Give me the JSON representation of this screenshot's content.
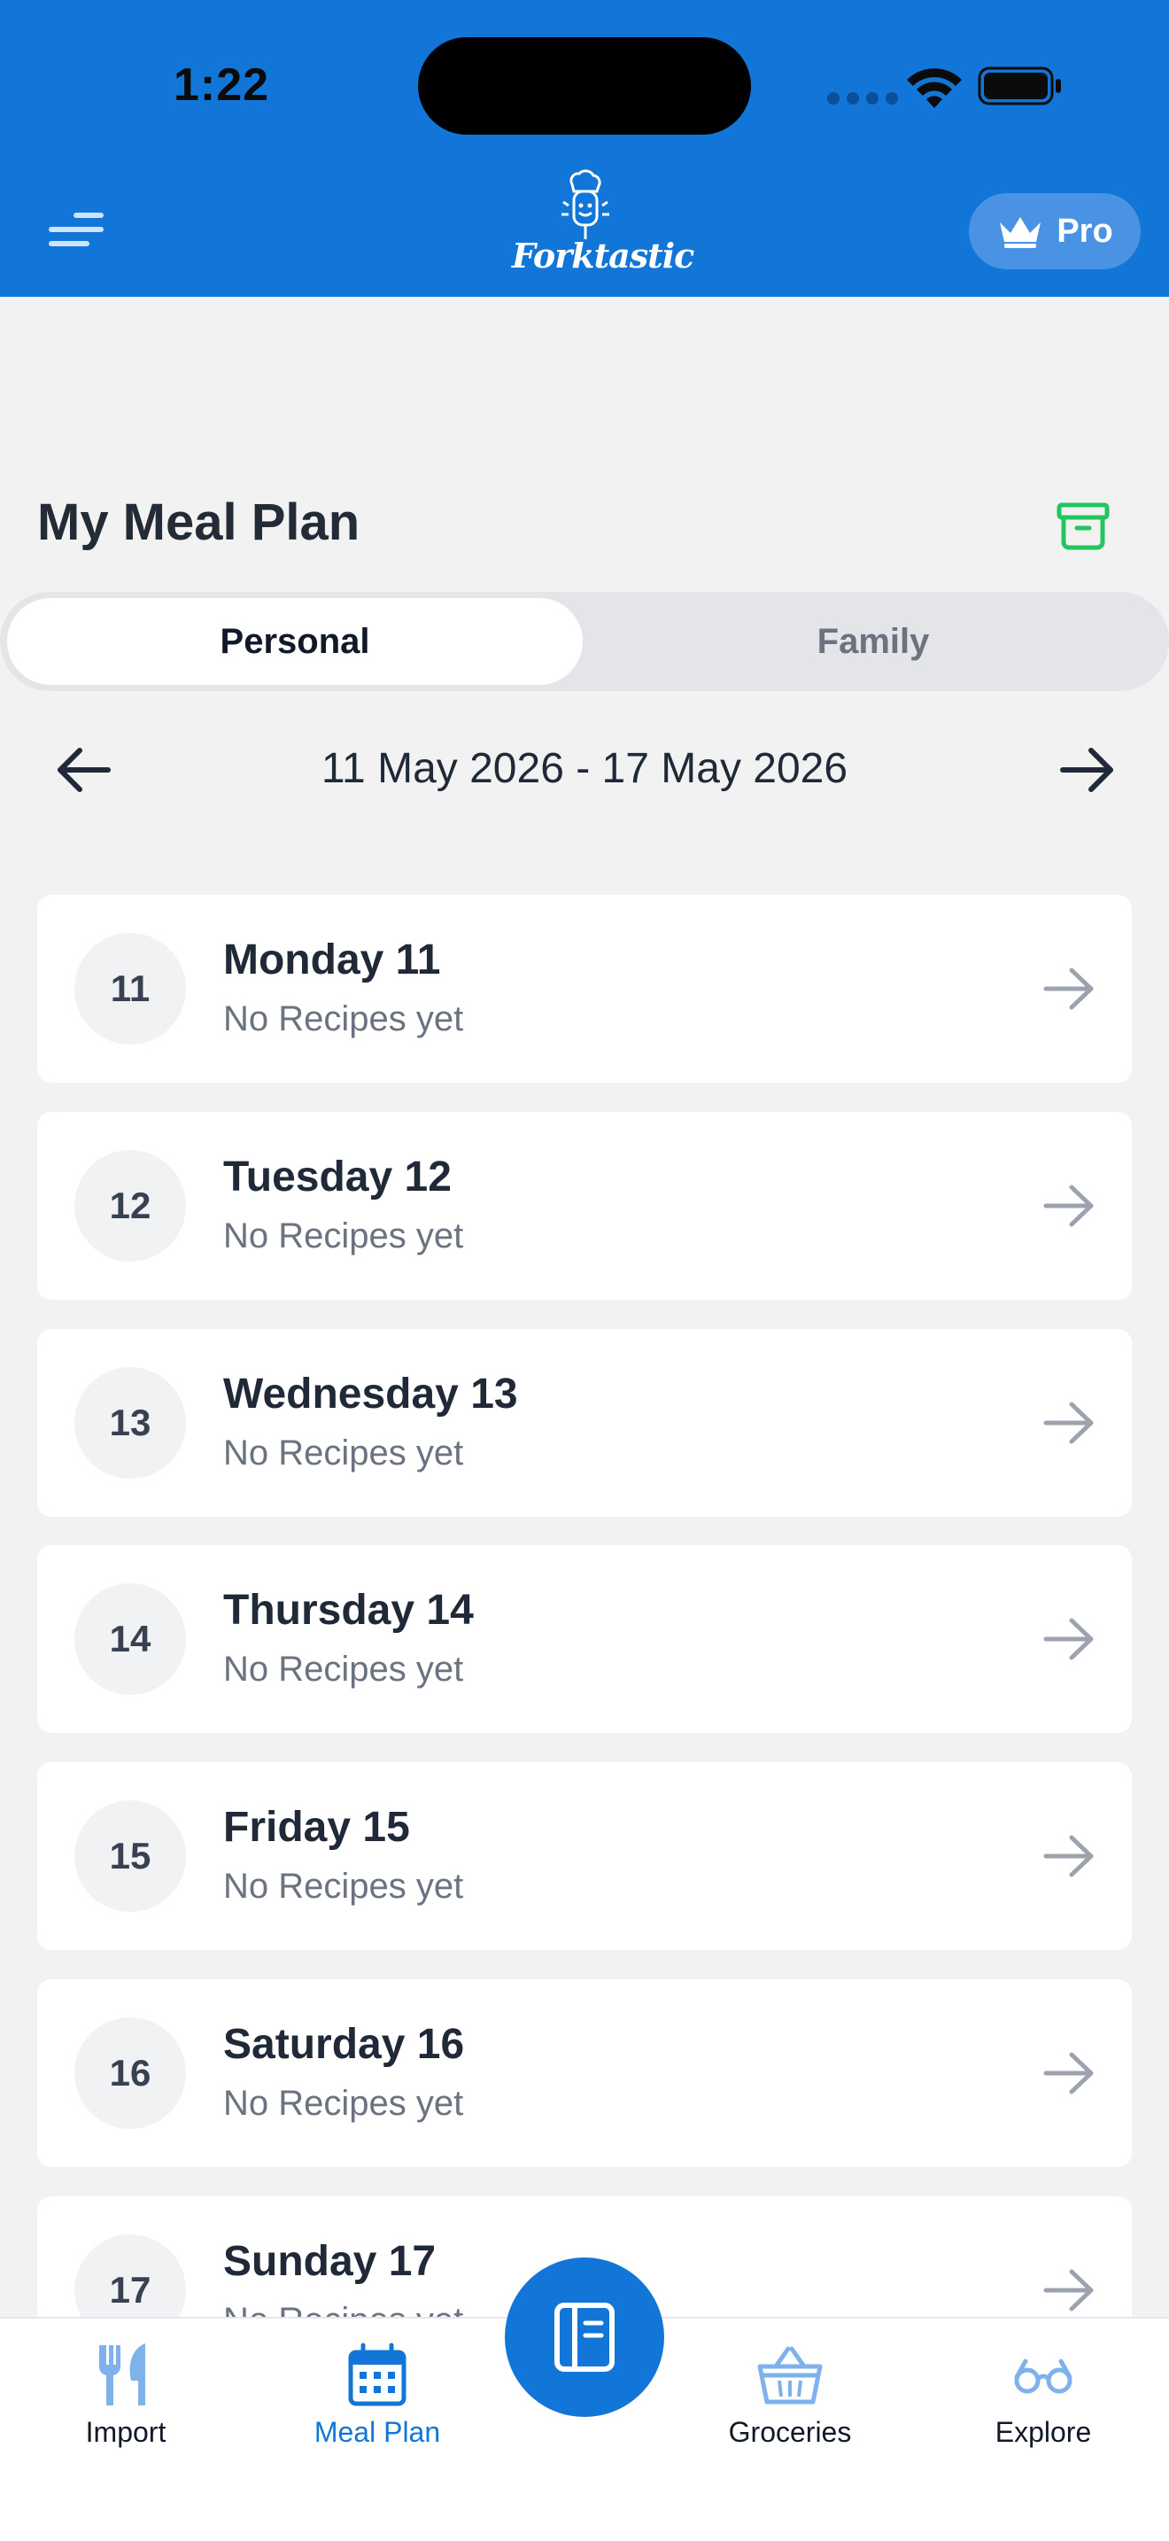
{
  "status_bar": {
    "time": "1:22"
  },
  "header": {
    "logo_text": "Forktastic",
    "pro_label": "Pro"
  },
  "page": {
    "title": "My Meal Plan"
  },
  "tabs": [
    {
      "label": "Personal",
      "selected": true
    },
    {
      "label": "Family",
      "selected": false
    }
  ],
  "week": {
    "range": "11 May 2026 - 17 May 2026"
  },
  "days": [
    {
      "number": "11",
      "name": "Monday 11",
      "status": "No Recipes yet"
    },
    {
      "number": "12",
      "name": "Tuesday 12",
      "status": "No Recipes yet"
    },
    {
      "number": "13",
      "name": "Wednesday 13",
      "status": "No Recipes yet"
    },
    {
      "number": "14",
      "name": "Thursday 14",
      "status": "No Recipes yet"
    },
    {
      "number": "15",
      "name": "Friday 15",
      "status": "No Recipes yet"
    },
    {
      "number": "16",
      "name": "Saturday 16",
      "status": "No Recipes yet"
    },
    {
      "number": "17",
      "name": "Sunday 17",
      "status": "No Recipes yet"
    }
  ],
  "bottom_nav": {
    "items": [
      {
        "label": "Import",
        "icon": "utensils-icon",
        "active": false
      },
      {
        "label": "Meal Plan",
        "icon": "calendar-icon",
        "active": true
      },
      {
        "label": "Groceries",
        "icon": "basket-icon",
        "active": false
      },
      {
        "label": "Explore",
        "icon": "glasses-icon",
        "active": false
      }
    ],
    "center_icon": "recipe-book-icon"
  },
  "colors": {
    "brand_blue": "#1275d8",
    "pro_pill": "#4a93e4",
    "archive_green": "#22c55e",
    "background": "#f2f2f2",
    "muted_text": "#6b7280",
    "nav_icon_inactive": "#7fb1ea"
  }
}
